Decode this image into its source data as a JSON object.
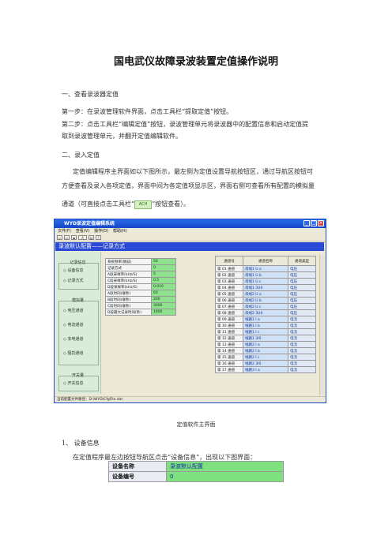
{
  "title": "国电武仪故障录波装置定值操作说明",
  "s1": {
    "heading": "一、查看录波器定值",
    "step1": "第一步：在录波管理软件界面，点击工具栏“提取定值”按钮。",
    "step2a": "第二步：点击工具栏“编辑定值”按钮，录波管理单元将录波器中的配置信息和启动定值提",
    "step2b": "取到录波管理单元，并翻开定值编辑软件。"
  },
  "s2": {
    "heading": "二、录入定值",
    "p1": "定值编辑程序主界面如以下图所示，最左侧为定值设置导航按钮区，通过导航区按钮可",
    "p2": "方便查看及录入各项定值，界面中间为各定值项显示区，界面右侧可查看所有配置的模拟量",
    "p3a": "通道（可直接点击工具栏“",
    "ach_icon_text": "ACH",
    "p3b": "”按钮查看）。"
  },
  "app": {
    "window_title": "WYD录波定值编辑系统",
    "menu": [
      "文件(F)",
      "查看(V)",
      "操作(O)",
      "帮助(H)"
    ],
    "toolbar_buttons": [
      "new-icon",
      "open-icon",
      "save-icon",
      "ach-icon",
      "print-icon",
      "help-icon"
    ],
    "banner": "录波默认配置——记录方式",
    "nav_groups": [
      {
        "label": "记录信息",
        "items": [
          "设备信息",
          "记录方式"
        ]
      },
      {
        "label": "模拟量",
        "items": [
          "电压通道",
          "电流通道",
          "非电通道",
          "阻抗通道"
        ]
      },
      {
        "label": "开关量",
        "items": [
          "开关信息"
        ]
      }
    ],
    "settings": [
      {
        "k": "系统频率(赫兹)",
        "v": "50"
      },
      {
        "k": "记录方式",
        "v": "0"
      },
      {
        "k": "A段采样率(kHz/S)",
        "v": "5"
      },
      {
        "k": "C段采样率(kHz/S)",
        "v": "0.5"
      },
      {
        "k": "D段采样率(kHz/S)",
        "v": "0.010"
      },
      {
        "k": "A段时间(毫秒)",
        "v": "60"
      },
      {
        "k": "B段时间(毫秒)",
        "v": "200"
      },
      {
        "k": "C段时间(毫秒)",
        "v": "3000"
      },
      {
        "k": "D段最大记录时间(秒)",
        "v": "1800"
      }
    ],
    "channel_headers": [
      "通道号",
      "通道名称",
      "通道类型"
    ],
    "channels": [
      {
        "n": "第 01 通道",
        "name": "母线1 U a",
        "type": "电压"
      },
      {
        "n": "第 02 通道",
        "name": "母线1 U b",
        "type": "电压"
      },
      {
        "n": "第 03 通道",
        "name": "母线1 U c",
        "type": "电压"
      },
      {
        "n": "第 04 通道",
        "name": "母线1 3U0",
        "type": "电压"
      },
      {
        "n": "第 05 通道",
        "name": "母线2 U a",
        "type": "电压"
      },
      {
        "n": "第 06 通道",
        "name": "母线2 U b",
        "type": "电压"
      },
      {
        "n": "第 07 通道",
        "name": "母线2 U c",
        "type": "电压"
      },
      {
        "n": "第 08 通道",
        "name": "母线2 3U0",
        "type": "电压"
      },
      {
        "n": "第 09 通道",
        "name": "线路1 I a",
        "type": "电流"
      },
      {
        "n": "第 10 通道",
        "name": "线路1 I b",
        "type": "电流"
      },
      {
        "n": "第 11 通道",
        "name": "线路1 I c",
        "type": "电流"
      },
      {
        "n": "第 12 通道",
        "name": "线路1 3I0",
        "type": "电流"
      },
      {
        "n": "第 13 通道",
        "name": "线路2 I a",
        "type": "电流"
      },
      {
        "n": "第 14 通道",
        "name": "线路2 I b",
        "type": "电流"
      },
      {
        "n": "第 15 通道",
        "name": "线路2 I c",
        "type": "电流"
      },
      {
        "n": "第 16 通道",
        "name": "线路2 3I0",
        "type": "电流"
      },
      {
        "n": "第 17 通道",
        "name": "线路3 I a",
        "type": "电流"
      }
    ],
    "status": "当前配置文件路径：D:\\WYD\\CfgFile.dat"
  },
  "caption": "定值软件主界面",
  "s3": {
    "heading": "1、 设备信息",
    "p1": "在定值程序最左边按钮导航区点击“设备信息”，出现以下图界面："
  },
  "device_table": [
    {
      "k": "设备名称",
      "v": "录波默认配置"
    },
    {
      "k": "设备编号",
      "v": "0"
    }
  ]
}
